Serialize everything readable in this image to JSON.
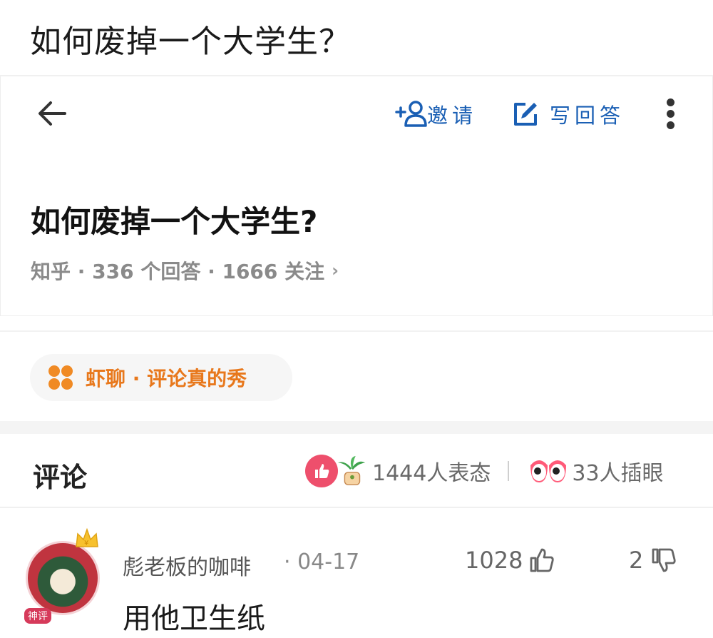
{
  "caption": {
    "title": "如何废掉一个大学生？"
  },
  "toolbar": {
    "back_icon": "arrow-left-icon",
    "invite_label": "邀请",
    "write_label": "写回答",
    "more_icon": "more-vertical-icon",
    "accent_color": "#1a5fb4"
  },
  "question": {
    "title": "如何废掉一个大学生?",
    "meta": "知乎 · 336 个回答 · 1666 关注",
    "chevron": "›"
  },
  "promo": {
    "label": "虾聊 · 评论真的秀",
    "color": "#f08a24"
  },
  "comments_section": {
    "title": "评论",
    "reaction_count": "1444人表态",
    "eyes_count": "33人插眼"
  },
  "comment": {
    "author": "彪老板的咖啡",
    "date": "· 04-17",
    "likes": "1028",
    "dislikes": "2",
    "text": "用他卫生纸",
    "badge": "神评"
  }
}
